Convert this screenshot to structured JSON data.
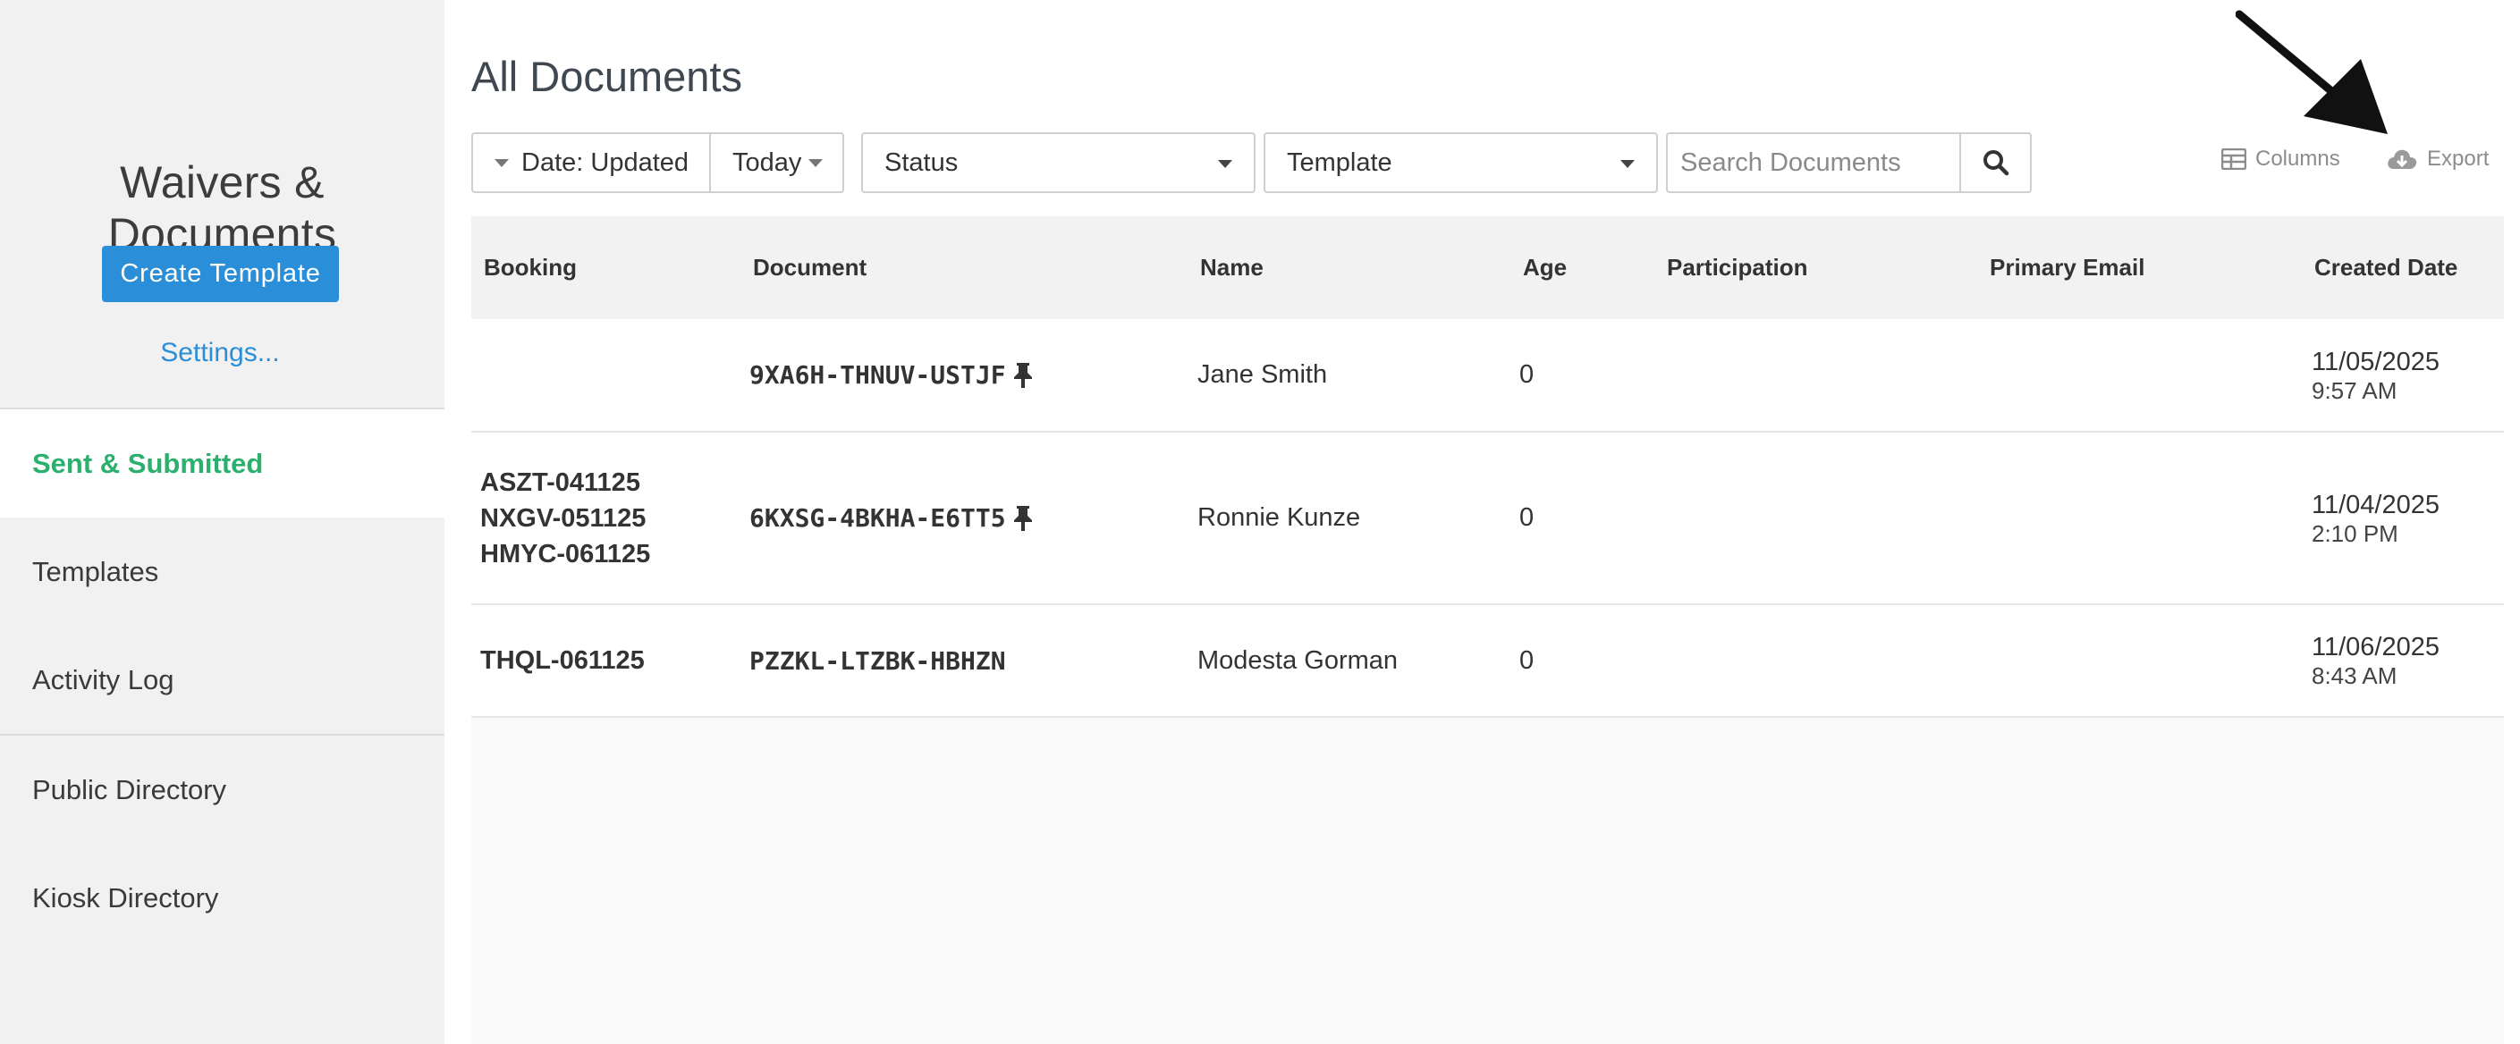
{
  "sidebar": {
    "title": "Waivers & Documents",
    "create_button": "Create Template",
    "settings_link": "Settings...",
    "nav": [
      {
        "label": "Sent & Submitted",
        "active": true
      },
      {
        "label": "Templates"
      },
      {
        "label": "Activity Log"
      },
      {
        "label": "Public Directory"
      },
      {
        "label": "Kiosk Directory"
      }
    ]
  },
  "main": {
    "title": "All Documents",
    "filters": {
      "date_label": "Date: Updated",
      "range_label": "Today",
      "status_label": "Status",
      "template_label": "Template",
      "search_placeholder": "Search Documents"
    },
    "actions": {
      "columns_label": "Columns",
      "export_label": "Export"
    },
    "table": {
      "columns": [
        "Booking",
        "Document",
        "Name",
        "Age",
        "Participation",
        "Primary Email",
        "Created Date"
      ],
      "rows": [
        {
          "bookings": [],
          "document": "9XA6H-THNUV-USTJF",
          "pinned": true,
          "name": "Jane Smith",
          "age": "0",
          "participation": "",
          "email": "",
          "created_date": "11/05/2025",
          "created_time": "9:57 AM"
        },
        {
          "bookings": [
            "ASZT-041125",
            "NXGV-051125",
            "HMYC-061125"
          ],
          "document": "6KXSG-4BKHA-E6TT5",
          "pinned": true,
          "name": "Ronnie Kunze",
          "age": "0",
          "participation": "",
          "email": "",
          "created_date": "11/04/2025",
          "created_time": "2:10 PM"
        },
        {
          "bookings": [
            "THQL-061125"
          ],
          "document": "PZZKL-LTZBK-HBHZN",
          "pinned": false,
          "name": "Modesta Gorman",
          "age": "0",
          "participation": "",
          "email": "",
          "created_date": "11/06/2025",
          "created_time": "8:43 AM"
        }
      ]
    }
  },
  "colors": {
    "primary": "#2a8fd8",
    "active_nav": "#2bb06e",
    "sidebar_bg": "#f1f1f1"
  },
  "icons": {
    "search": "search-icon",
    "columns": "columns-icon",
    "export": "cloud-download-icon",
    "pin": "pin-icon",
    "annotation": "arrow-annotation"
  }
}
